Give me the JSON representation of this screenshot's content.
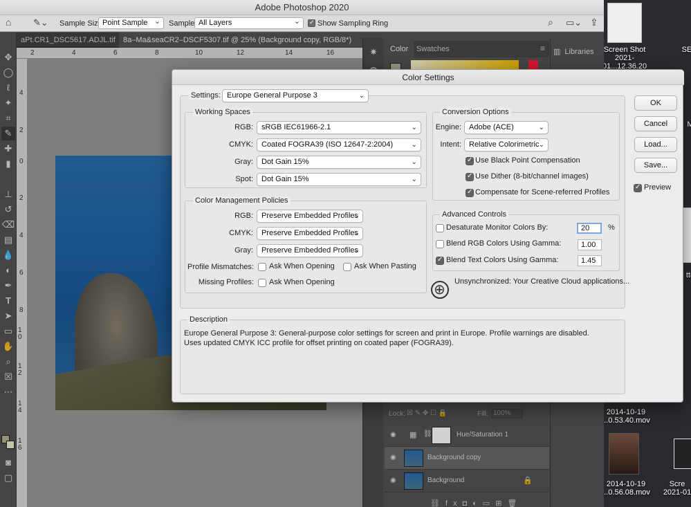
{
  "app": {
    "title": "Adobe Photoshop 2020"
  },
  "options_bar": {
    "sample_size_label": "Sample Size:",
    "sample_size_value": "Point Sample",
    "sample_label": "Sample:",
    "sample_value": "All Layers",
    "show_ring_label": "Show Sampling Ring",
    "show_ring_checked": true
  },
  "tabs": [
    {
      "label": "aPt.CR1_DSC5617.ADJL.tif",
      "active": false
    },
    {
      "label": "8a–Ma&seaCR2–DSCF5307.tif @ 25% (Background copy, RGB/8*)",
      "active": true
    }
  ],
  "rulers": {
    "h": [
      "2",
      "4",
      "6",
      "8",
      "10",
      "12",
      "14",
      "16"
    ],
    "v": [
      "4",
      "2",
      "0",
      "2",
      "4",
      "6",
      "8",
      "1 0",
      "1 2",
      "1 4",
      "1 6"
    ]
  },
  "panels": {
    "color_tab": "Color",
    "swatches_tab": "Swatches",
    "libraries": "Libraries"
  },
  "layers": {
    "lock_label": "Lock:",
    "fill_label": "Fill:",
    "fill_value": "100%",
    "rows": [
      {
        "name": "Hue/Saturation 1",
        "selected": false
      },
      {
        "name": "Background copy",
        "selected": true
      },
      {
        "name": "Background",
        "selected": false
      }
    ]
  },
  "desktop": {
    "items": [
      {
        "label": "Screen Shot\n2021-01...12.36.20"
      },
      {
        "label": "SE"
      },
      {
        "label": "2014-10-19\n...0.53.40.mov"
      },
      {
        "label": "2014-10-19\n...0.56.08.mov"
      },
      {
        "label": "Scre\n2021-01"
      },
      {
        "label": "M"
      },
      {
        "label": "tto"
      }
    ]
  },
  "dialog": {
    "title": "Color Settings",
    "settings_label": "Settings:",
    "settings_value": "Europe General Purpose 3",
    "working_spaces": {
      "title": "Working Spaces",
      "rgb_label": "RGB:",
      "rgb_value": "sRGB IEC61966-2.1",
      "cmyk_label": "CMYK:",
      "cmyk_value": "Coated FOGRA39 (ISO 12647-2:2004)",
      "gray_label": "Gray:",
      "gray_value": "Dot Gain 15%",
      "spot_label": "Spot:",
      "spot_value": "Dot Gain 15%"
    },
    "policies": {
      "title": "Color Management Policies",
      "rgb_label": "RGB:",
      "rgb_value": "Preserve Embedded Profiles",
      "cmyk_label": "CMYK:",
      "cmyk_value": "Preserve Embedded Profiles",
      "gray_label": "Gray:",
      "gray_value": "Preserve Embedded Profiles",
      "mismatch_label": "Profile Mismatches:",
      "mismatch_open": "Ask When Opening",
      "mismatch_paste": "Ask When Pasting",
      "missing_label": "Missing Profiles:",
      "missing_open": "Ask When Opening"
    },
    "conversion": {
      "title": "Conversion Options",
      "engine_label": "Engine:",
      "engine_value": "Adobe (ACE)",
      "intent_label": "Intent:",
      "intent_value": "Relative Colorimetric",
      "bpc_label": "Use Black Point Compensation",
      "dither_label": "Use Dither (8-bit/channel images)",
      "scene_label": "Compensate for Scene-referred Profiles"
    },
    "advanced": {
      "title": "Advanced Controls",
      "desaturate_label": "Desaturate Monitor Colors By:",
      "desaturate_value": "20",
      "desaturate_unit": "%",
      "blend_rgb_label": "Blend RGB Colors Using Gamma:",
      "blend_rgb_value": "1.00",
      "blend_text_label": "Blend Text Colors Using Gamma:",
      "blend_text_value": "1.45"
    },
    "sync_text": "Unsynchronized: Your Creative Cloud applications...",
    "buttons": {
      "ok": "OK",
      "cancel": "Cancel",
      "load": "Load...",
      "save": "Save..."
    },
    "preview_label": "Preview",
    "description": {
      "title": "Description",
      "text": "Europe General Purpose 3:  General-purpose color settings for screen and print in Europe. Profile warnings are disabled. Uses updated CMYK ICC profile for offset printing on coated paper (FOGRA39)."
    }
  }
}
